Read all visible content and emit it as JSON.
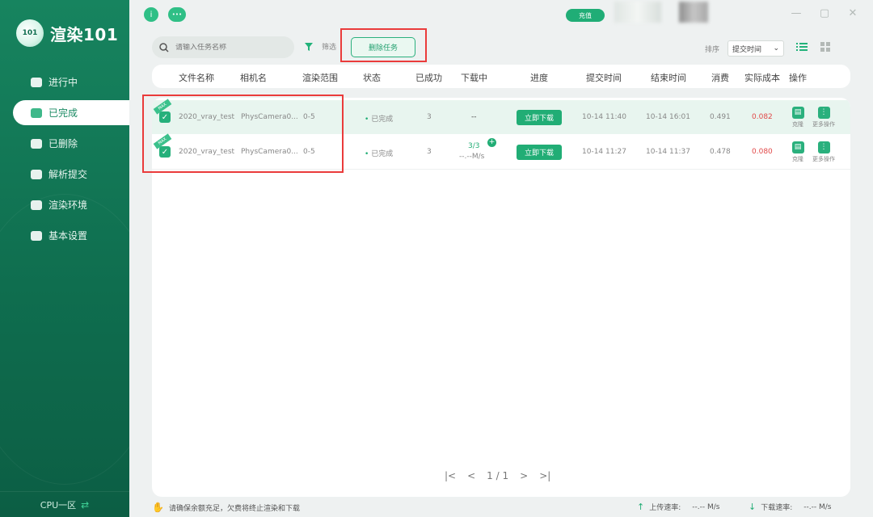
{
  "app": {
    "logo_mark": "101",
    "logo_text": "渲染101"
  },
  "sidebar": {
    "items": [
      {
        "label": "进行中",
        "icon": "cloud-icon"
      },
      {
        "label": "已完成",
        "icon": "check-cloud-icon"
      },
      {
        "label": "已删除",
        "icon": "delete-cloud-icon"
      },
      {
        "label": "解析提交",
        "icon": "camera-icon"
      },
      {
        "label": "渲染环境",
        "icon": "box-icon"
      },
      {
        "label": "基本设置",
        "icon": "folder-icon"
      }
    ],
    "active_index": 1,
    "cpu_zone": "CPU一区"
  },
  "topbar": {
    "shield_glyph": "i",
    "chat_glyph": "•••",
    "recharge": "充值"
  },
  "toolbar": {
    "search_placeholder": "请输入任务名称",
    "filter": "筛选",
    "delete_task": "删除任务",
    "sort": "排序",
    "sort_value": "提交时间"
  },
  "table": {
    "headers": [
      "文件名称",
      "相机名",
      "渲染范围",
      "状态",
      "已成功",
      "下载中",
      "进度",
      "提交时间",
      "结束时间",
      "消费",
      "实际成本",
      "操作"
    ],
    "rows": [
      {
        "file": "2020_vray_test",
        "camera": "PhysCamera0...",
        "range": "0-5",
        "status": "已完成",
        "success": "3",
        "downloading": "--",
        "downloading_speed": "",
        "progress": "立即下载",
        "submit": "10-14 11:40",
        "end": "10-14 16:01",
        "consume": "0.491",
        "cost": "0.082",
        "op1": "克隆",
        "op2": "更多操作",
        "badge": "MAX"
      },
      {
        "file": "2020_vray_test",
        "camera": "PhysCamera0...",
        "range": "0-5",
        "status": "已完成",
        "success": "3",
        "downloading": "3/3",
        "downloading_speed": "--.--M/s",
        "progress": "立即下载",
        "submit": "10-14 11:27",
        "end": "10-14 11:37",
        "consume": "0.478",
        "cost": "0.080",
        "op1": "克隆",
        "op2": "更多操作",
        "badge": "MAX"
      }
    ]
  },
  "pager": {
    "first": "|<",
    "prev": "<",
    "label": "1 / 1",
    "next": ">",
    "last": ">|"
  },
  "footer": {
    "warning": "请确保余额充足，欠费将终止渲染和下载",
    "upload_label": "上传速率:",
    "upload_value": "--.-- M/s",
    "download_label": "下载速率:",
    "download_value": "--.-- M/s"
  },
  "colors": {
    "accent": "#21ad75",
    "sidebar": "#17845f",
    "cost": "#e14848",
    "highlight": "#ea3b3b"
  }
}
